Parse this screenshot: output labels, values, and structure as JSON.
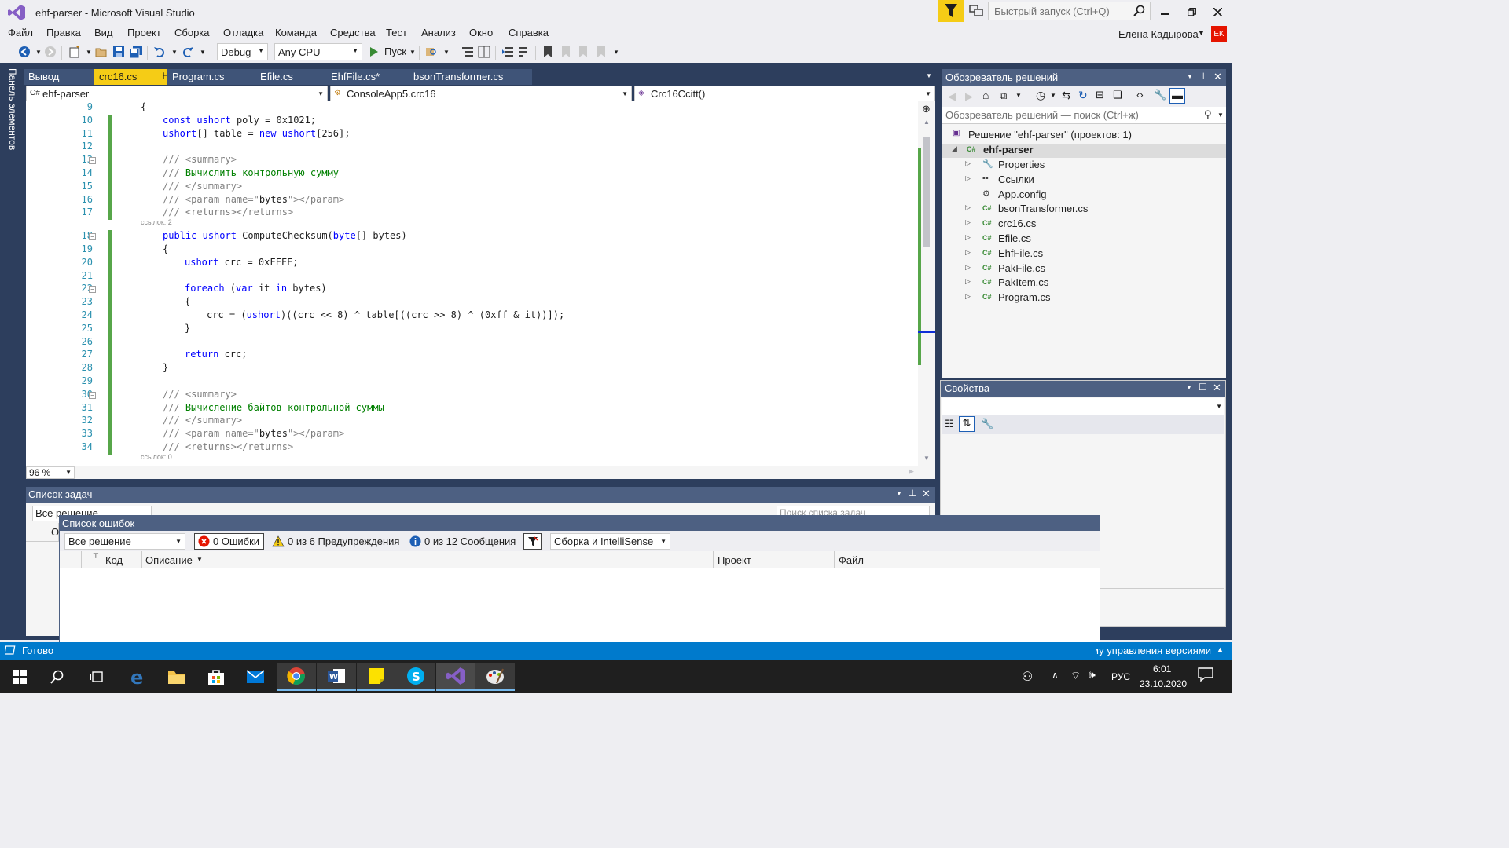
{
  "window": {
    "title": "ehf-parser - Microsoft Visual Studio"
  },
  "quick_launch": {
    "placeholder": "Быстрый запуск (Ctrl+Q)"
  },
  "menu": [
    "Файл",
    "Правка",
    "Вид",
    "Проект",
    "Сборка",
    "Отладка",
    "Команда",
    "Средства",
    "Тест",
    "Анализ",
    "Окно",
    "Справка"
  ],
  "user": {
    "name": "Елена Кадырова",
    "initials": "EK"
  },
  "toolbar": {
    "config": "Debug",
    "platform": "Any CPU",
    "run_label": "Пуск"
  },
  "left_strip": {
    "label": "Панель элементов"
  },
  "editor_tabs": [
    {
      "label": "Вывод",
      "active": false
    },
    {
      "label": "crc16.cs",
      "active": true
    },
    {
      "label": "Program.cs",
      "active": false
    },
    {
      "label": "Efile.cs",
      "active": false
    },
    {
      "label": "EhfFile.cs*",
      "active": false
    },
    {
      "label": "bsonTransformer.cs",
      "active": false
    }
  ],
  "nav": {
    "project": "ehf-parser",
    "type": "ConsoleApp5.crc16",
    "member": "Crc16Ccitt()"
  },
  "code": {
    "lines": [
      {
        "n": "9",
        "indent": 1,
        "parts": [
          [
            "",
            "{"
          ]
        ]
      },
      {
        "n": "10",
        "indent": 2,
        "parts": [
          [
            "kw",
            "const"
          ],
          [
            "",
            " "
          ],
          [
            "kw",
            "ushort"
          ],
          [
            "",
            " poly = 0x1021;"
          ]
        ]
      },
      {
        "n": "11",
        "indent": 2,
        "parts": [
          [
            "kw",
            "ushort"
          ],
          [
            "",
            "[] table = "
          ],
          [
            "kw",
            "new"
          ],
          [
            "",
            " "
          ],
          [
            "kw",
            "ushort"
          ],
          [
            "",
            "[256];"
          ]
        ]
      },
      {
        "n": "12",
        "indent": 0,
        "parts": []
      },
      {
        "n": "13",
        "indent": 2,
        "fold": true,
        "parts": [
          [
            "dc",
            "/// <summary>"
          ]
        ]
      },
      {
        "n": "14",
        "indent": 2,
        "parts": [
          [
            "dc",
            "/// "
          ],
          [
            "cm",
            "Вычислить контрольную сумму"
          ]
        ]
      },
      {
        "n": "15",
        "indent": 2,
        "parts": [
          [
            "dc",
            "/// </summary>"
          ]
        ]
      },
      {
        "n": "16",
        "indent": 2,
        "parts": [
          [
            "dc",
            "/// <param name=\""
          ],
          [
            "",
            "bytes"
          ],
          [
            "dc",
            "\"></param>"
          ]
        ]
      },
      {
        "n": "17",
        "indent": 2,
        "parts": [
          [
            "dc",
            "/// <returns></returns>"
          ]
        ],
        "lens": "ссылок: 2"
      },
      {
        "n": "18",
        "indent": 2,
        "fold": true,
        "parts": [
          [
            "kw",
            "public"
          ],
          [
            "",
            " "
          ],
          [
            "kw",
            "ushort"
          ],
          [
            "",
            " ComputeChecksum("
          ],
          [
            "kw",
            "byte"
          ],
          [
            "",
            "[] bytes)"
          ]
        ]
      },
      {
        "n": "19",
        "indent": 2,
        "parts": [
          [
            "",
            "{"
          ]
        ]
      },
      {
        "n": "20",
        "indent": 3,
        "parts": [
          [
            "kw",
            "ushort"
          ],
          [
            "",
            " crc = 0xFFFF;"
          ]
        ]
      },
      {
        "n": "21",
        "indent": 0,
        "parts": []
      },
      {
        "n": "22",
        "indent": 3,
        "fold": true,
        "parts": [
          [
            "kw",
            "foreach"
          ],
          [
            "",
            " ("
          ],
          [
            "kw",
            "var"
          ],
          [
            "",
            " it "
          ],
          [
            "kw",
            "in"
          ],
          [
            "",
            " bytes)"
          ]
        ]
      },
      {
        "n": "23",
        "indent": 3,
        "parts": [
          [
            "",
            "{"
          ]
        ]
      },
      {
        "n": "24",
        "indent": 4,
        "parts": [
          [
            "",
            "crc = ("
          ],
          [
            "kw",
            "ushort"
          ],
          [
            "",
            ")((crc << 8) ^ table[((crc >> 8) ^ (0xff & it))]);"
          ]
        ]
      },
      {
        "n": "25",
        "indent": 3,
        "parts": [
          [
            "",
            "}"
          ]
        ]
      },
      {
        "n": "26",
        "indent": 0,
        "parts": []
      },
      {
        "n": "27",
        "indent": 3,
        "parts": [
          [
            "kw",
            "return"
          ],
          [
            "",
            " crc;"
          ]
        ]
      },
      {
        "n": "28",
        "indent": 2,
        "parts": [
          [
            "",
            "}"
          ]
        ]
      },
      {
        "n": "29",
        "indent": 0,
        "parts": []
      },
      {
        "n": "30",
        "indent": 2,
        "fold": true,
        "parts": [
          [
            "dc",
            "/// <summary>"
          ]
        ]
      },
      {
        "n": "31",
        "indent": 2,
        "parts": [
          [
            "dc",
            "/// "
          ],
          [
            "cm",
            "Вычисление байтов контрольной суммы"
          ]
        ]
      },
      {
        "n": "32",
        "indent": 2,
        "parts": [
          [
            "dc",
            "/// </summary>"
          ]
        ]
      },
      {
        "n": "33",
        "indent": 2,
        "parts": [
          [
            "dc",
            "/// <param name=\""
          ],
          [
            "",
            "bytes"
          ],
          [
            "dc",
            "\"></param>"
          ]
        ]
      },
      {
        "n": "34",
        "indent": 2,
        "parts": [
          [
            "dc",
            "/// <returns></returns>"
          ]
        ],
        "lens": "ссылок: 0"
      }
    ]
  },
  "zoom": "96 %",
  "solution_explorer": {
    "title": "Обозреватель решений",
    "search_placeholder": "Обозреватель решений — поиск (Ctrl+ж)",
    "solution_label": "Решение \"ehf-parser\"  (проектов: 1)",
    "project_label": "ehf-parser",
    "items": [
      {
        "label": "Properties",
        "icon": "wrench-icon",
        "expandable": true
      },
      {
        "label": "Ссылки",
        "icon": "references-icon",
        "expandable": true
      },
      {
        "label": "App.config",
        "icon": "config-icon",
        "expandable": false
      },
      {
        "label": "bsonTransformer.cs",
        "icon": "csharp-file-icon",
        "expandable": true
      },
      {
        "label": "crc16.cs",
        "icon": "csharp-file-icon",
        "expandable": true
      },
      {
        "label": "Efile.cs",
        "icon": "csharp-file-icon",
        "expandable": true
      },
      {
        "label": "EhfFile.cs",
        "icon": "csharp-file-icon",
        "expandable": true
      },
      {
        "label": "PakFile.cs",
        "icon": "csharp-file-icon",
        "expandable": true
      },
      {
        "label": "PakItem.cs",
        "icon": "csharp-file-icon",
        "expandable": true
      },
      {
        "label": "Program.cs",
        "icon": "csharp-file-icon",
        "expandable": true
      }
    ]
  },
  "properties": {
    "title": "Свойства"
  },
  "tasks": {
    "title": "Список задач",
    "filter": "Все решение",
    "search_placeholder": "Поиск списка задач",
    "col_partial": "О"
  },
  "errors": {
    "title": "Список ошибок",
    "scope": "Все решение",
    "errors_btn": "0 Ошибки",
    "warnings_btn": "0 из 6 Предупреждения",
    "messages_btn": "0 из 12 Сообщения",
    "build_filter": "Сборка и IntelliSense",
    "columns": [
      "Код",
      "Описание",
      "Проект",
      "Файл"
    ]
  },
  "status": {
    "ready": "Готово",
    "vcs": "Добавить в систему управления версиями"
  },
  "taskbar": {
    "lang": "РУС",
    "time": "6:01",
    "date": "23.10.2020"
  },
  "colors": {
    "accent": "#007acc",
    "tab_active": "#f5cc16",
    "frame": "#2d3e5d",
    "avatar": "#e51400"
  }
}
